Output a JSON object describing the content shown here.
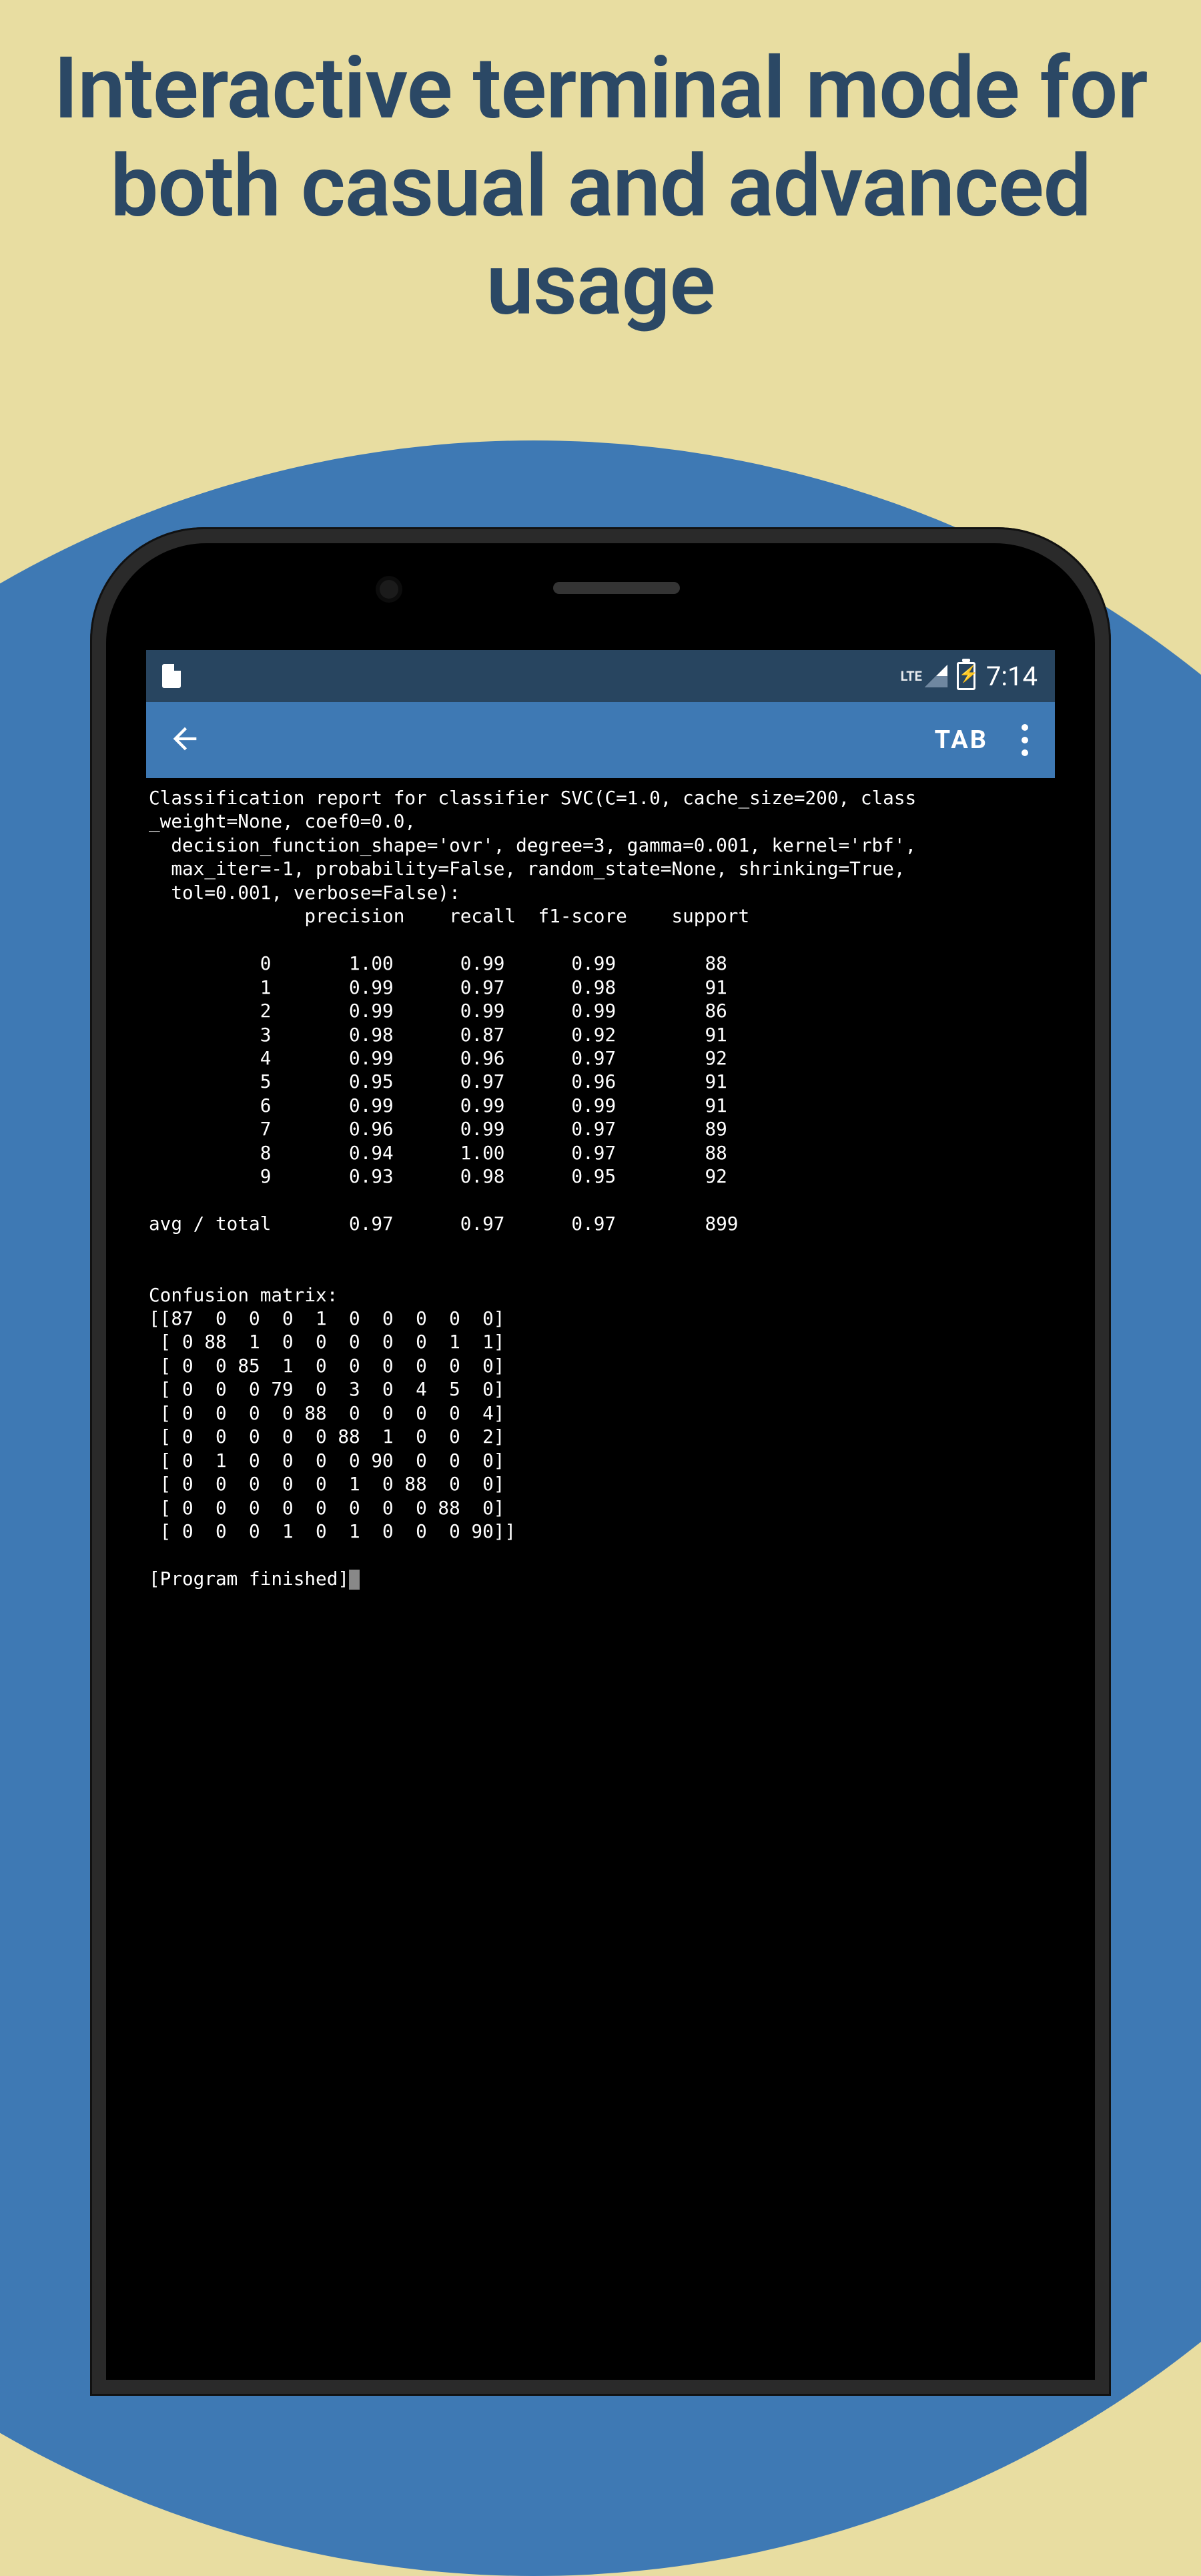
{
  "marketing": {
    "headline": "Interactive terminal mode for both casual and advanced usage"
  },
  "statusbar": {
    "network_label": "LTE",
    "time": "7:14"
  },
  "actionbar": {
    "tab_label": "TAB"
  },
  "terminal": {
    "header_lines": [
      "Classification report for classifier SVC(C=1.0, cache_size=200, class_weight=None, coef0=0.0,",
      "  decision_function_shape='ovr', degree=3, gamma=0.001, kernel='rbf',",
      "  max_iter=-1, probability=False, random_state=None, shrinking=True,",
      "  tol=0.001, verbose=False):"
    ],
    "report_columns": [
      "precision",
      "recall",
      "f1-score",
      "support"
    ],
    "report_rows": [
      {
        "label": "0",
        "precision": "1.00",
        "recall": "0.99",
        "f1": "0.99",
        "support": "88"
      },
      {
        "label": "1",
        "precision": "0.99",
        "recall": "0.97",
        "f1": "0.98",
        "support": "91"
      },
      {
        "label": "2",
        "precision": "0.99",
        "recall": "0.99",
        "f1": "0.99",
        "support": "86"
      },
      {
        "label": "3",
        "precision": "0.98",
        "recall": "0.87",
        "f1": "0.92",
        "support": "91"
      },
      {
        "label": "4",
        "precision": "0.99",
        "recall": "0.96",
        "f1": "0.97",
        "support": "92"
      },
      {
        "label": "5",
        "precision": "0.95",
        "recall": "0.97",
        "f1": "0.96",
        "support": "91"
      },
      {
        "label": "6",
        "precision": "0.99",
        "recall": "0.99",
        "f1": "0.99",
        "support": "91"
      },
      {
        "label": "7",
        "precision": "0.96",
        "recall": "0.99",
        "f1": "0.97",
        "support": "89"
      },
      {
        "label": "8",
        "precision": "0.94",
        "recall": "1.00",
        "f1": "0.97",
        "support": "88"
      },
      {
        "label": "9",
        "precision": "0.93",
        "recall": "0.98",
        "f1": "0.95",
        "support": "92"
      }
    ],
    "avg_row": {
      "label": "avg / total",
      "precision": "0.97",
      "recall": "0.97",
      "f1": "0.97",
      "support": "899"
    },
    "confusion_title": "Confusion matrix:",
    "confusion_matrix": [
      [
        87,
        0,
        0,
        0,
        1,
        0,
        0,
        0,
        0,
        0
      ],
      [
        0,
        88,
        1,
        0,
        0,
        0,
        0,
        0,
        1,
        1
      ],
      [
        0,
        0,
        85,
        1,
        0,
        0,
        0,
        0,
        0,
        0
      ],
      [
        0,
        0,
        0,
        79,
        0,
        3,
        0,
        4,
        5,
        0
      ],
      [
        0,
        0,
        0,
        0,
        88,
        0,
        0,
        0,
        0,
        4
      ],
      [
        0,
        0,
        0,
        0,
        0,
        88,
        1,
        0,
        0,
        2
      ],
      [
        0,
        1,
        0,
        0,
        0,
        0,
        90,
        0,
        0,
        0
      ],
      [
        0,
        0,
        0,
        0,
        0,
        1,
        0,
        88,
        0,
        0
      ],
      [
        0,
        0,
        0,
        0,
        0,
        0,
        0,
        0,
        88,
        0
      ],
      [
        0,
        0,
        0,
        1,
        0,
        1,
        0,
        0,
        0,
        90
      ]
    ],
    "finished_label": "[Program finished]"
  }
}
